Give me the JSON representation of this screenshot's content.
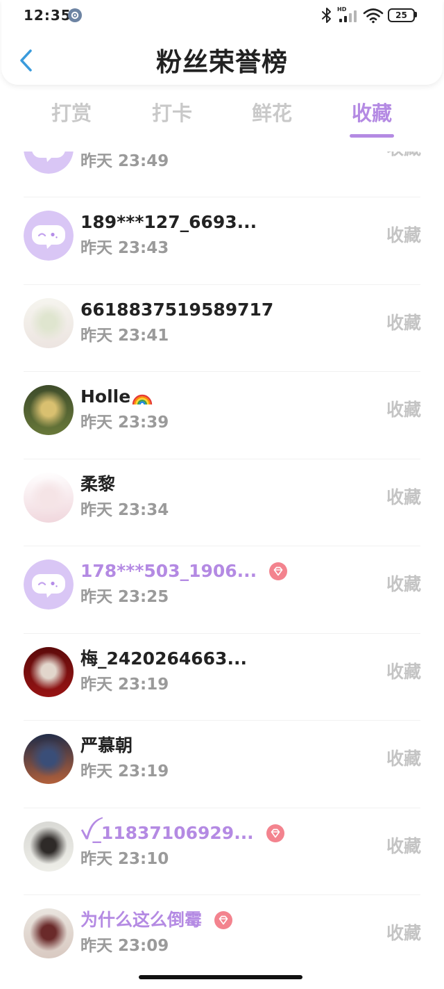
{
  "status_bar": {
    "time": "12:35",
    "network_label": "HD",
    "battery": "25",
    "settings_icon": "settings-gear-icon",
    "icons": [
      "bluetooth-icon",
      "signal-icon",
      "wifi-icon",
      "battery-icon"
    ]
  },
  "header": {
    "title": "粉丝荣誉榜",
    "back_icon": "chevron-left-icon"
  },
  "tabs": [
    {
      "label": "打赏",
      "active": false
    },
    {
      "label": "打卡",
      "active": false
    },
    {
      "label": "鲜花",
      "active": false
    },
    {
      "label": "收藏",
      "active": true
    }
  ],
  "colors": {
    "accent": "#b48ae3",
    "back": "#3a9bdc",
    "tab_inactive": "#c9c9c9",
    "name": "#222222",
    "time": "#9a9a9a",
    "action": "#c4c4c4",
    "badge": "#f3838e",
    "default_avatar": "#d9c6f5"
  },
  "list": {
    "items": [
      {
        "name": "",
        "time": "昨天 23:49",
        "action": "收藏",
        "avatar": "default",
        "vip": false,
        "badge": false
      },
      {
        "name": "189***127_6693...",
        "time": "昨天 23:43",
        "action": "收藏",
        "avatar": "default",
        "vip": false,
        "badge": false
      },
      {
        "name": "6618837519589717",
        "time": "昨天 23:41",
        "action": "收藏",
        "avatar": "photo",
        "palette": [
          "#f6f5ef",
          "#dfe5cf",
          "#ece4e0"
        ],
        "vip": false,
        "badge": false
      },
      {
        "name": "Holle",
        "emoji_icon": "rainbow-icon",
        "time": "昨天 23:39",
        "action": "收藏",
        "avatar": "photo",
        "palette": [
          "#3c4a2a",
          "#d9c070",
          "#6a7a3a"
        ],
        "vip": false,
        "badge": false
      },
      {
        "name": "柔黎",
        "time": "昨天 23:34",
        "action": "收藏",
        "avatar": "photo",
        "palette": [
          "#ffffff",
          "#f5e4e6",
          "#f0d6dc"
        ],
        "vip": false,
        "badge": false
      },
      {
        "name": "178***503_1906...",
        "time": "昨天 23:25",
        "action": "收藏",
        "avatar": "default",
        "vip": true,
        "badge": true
      },
      {
        "name": "梅_2420264663...",
        "time": "昨天 23:19",
        "action": "收藏",
        "avatar": "photo",
        "palette": [
          "#5a0a0a",
          "#e2d6cc",
          "#9a1414"
        ],
        "vip": false,
        "badge": false
      },
      {
        "name": "严慕朝",
        "time": "昨天 23:19",
        "action": "收藏",
        "avatar": "photo",
        "palette": [
          "#1c2b4a",
          "#3a4e78",
          "#b8623a"
        ],
        "vip": false,
        "badge": false
      },
      {
        "name": "ꪜ_11837106929...",
        "time": "昨天 23:10",
        "action": "收藏",
        "avatar": "photo",
        "palette": [
          "#d8d8d4",
          "#2e2a28",
          "#efefe9"
        ],
        "vip": true,
        "badge": true
      },
      {
        "name": "为什么这么倒霉",
        "time": "昨天 23:09",
        "action": "收藏",
        "avatar": "photo",
        "palette": [
          "#eae6e0",
          "#6a2a2a",
          "#d8c8c0"
        ],
        "vip": true,
        "badge": true
      }
    ]
  }
}
